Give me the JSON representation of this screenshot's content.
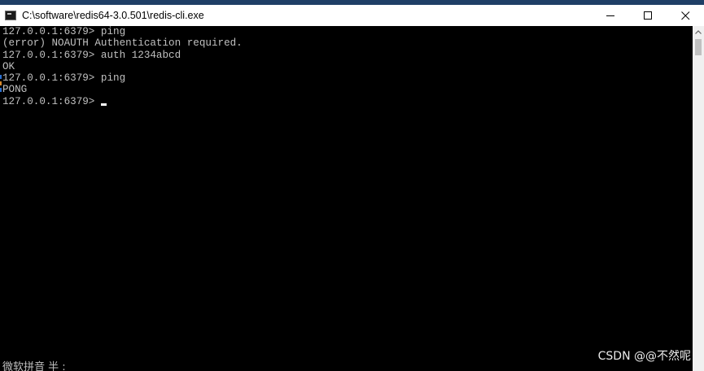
{
  "window": {
    "title": "C:\\software\\redis64-3.0.501\\redis-cli.exe",
    "minimize_glyph": "—",
    "maximize_glyph": "☐",
    "close_glyph": "✕"
  },
  "console": {
    "lines": [
      "127.0.0.1:6379> ping",
      "(error) NOAUTH Authentication required.",
      "127.0.0.1:6379> auth 1234abcd",
      "OK",
      "127.0.0.1:6379> ping",
      "PONG"
    ],
    "prompt": "127.0.0.1:6379>",
    "ime_status": "微软拼音 半 :"
  },
  "watermark": {
    "text": "CSDN @@不然呢"
  },
  "colors": {
    "console_bg": "#000000",
    "console_text": "#c0c0c0",
    "titlebar_bg": "#ffffff",
    "scrollbar_bg": "#f0f0f0"
  },
  "icons": {
    "app": "console-app-icon",
    "scroll_up": "chevron-up-icon"
  }
}
